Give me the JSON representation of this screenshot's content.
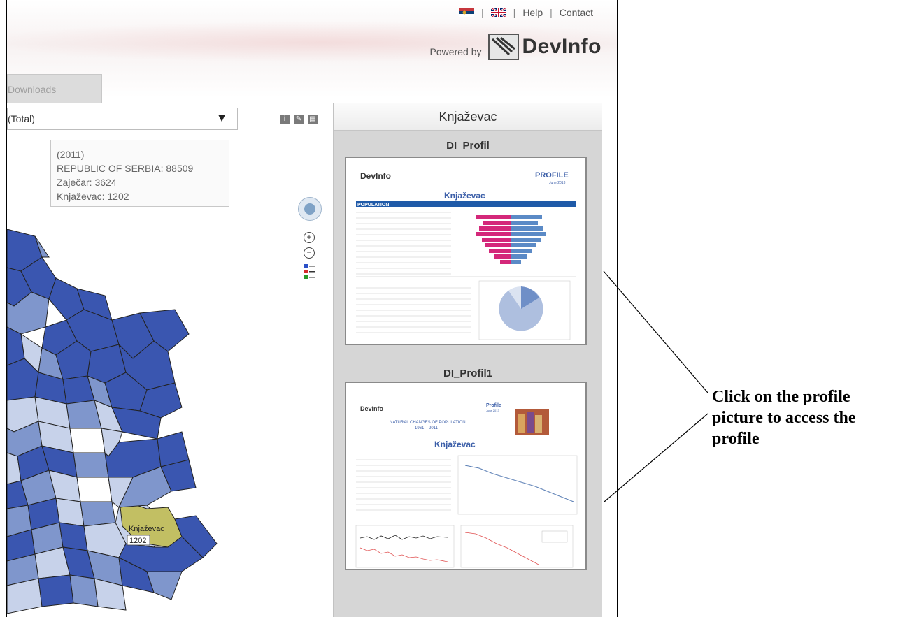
{
  "header": {
    "links": {
      "help": "Help",
      "contact": "Contact"
    },
    "powered_by": "Powered by",
    "logo_text": "DevInfo",
    "separator": "|"
  },
  "tabs": {
    "downloads_label": "Downloads"
  },
  "map": {
    "indicator_value": "(Total)",
    "legend": {
      "year": "(2011)",
      "line1": "REPUBLIC OF SERBIA: 88509",
      "line2": "Zaječar: 3624",
      "line3": "Knjaževac: 1202"
    },
    "highlight_label": "Knjaževac",
    "highlight_value": "1202",
    "colors": {
      "dark": "#3a56b0",
      "mid": "#7f96cc",
      "light": "#c7d2ea",
      "highlight": "#c2bf63"
    }
  },
  "panel": {
    "title": "Knjaževac",
    "profiles": [
      {
        "title": "DI_Profil",
        "doc": {
          "logo": "DevInfo",
          "heading": "PROFILE",
          "date": "June 2013",
          "place": "Knjaževac",
          "section": "POPULATION"
        }
      },
      {
        "title": "DI_Profil1",
        "doc": {
          "logo": "DevInfo",
          "heading": "Profile",
          "date": "June 2013",
          "subtitle": "NATURAL CHANGES OF POPULATION",
          "years": "1961 – 2011",
          "place": "Knjaževac"
        }
      }
    ]
  },
  "annotation": {
    "text_line1": "Click on the profile",
    "text_line2": "picture to access the",
    "text_line3": "profile"
  }
}
